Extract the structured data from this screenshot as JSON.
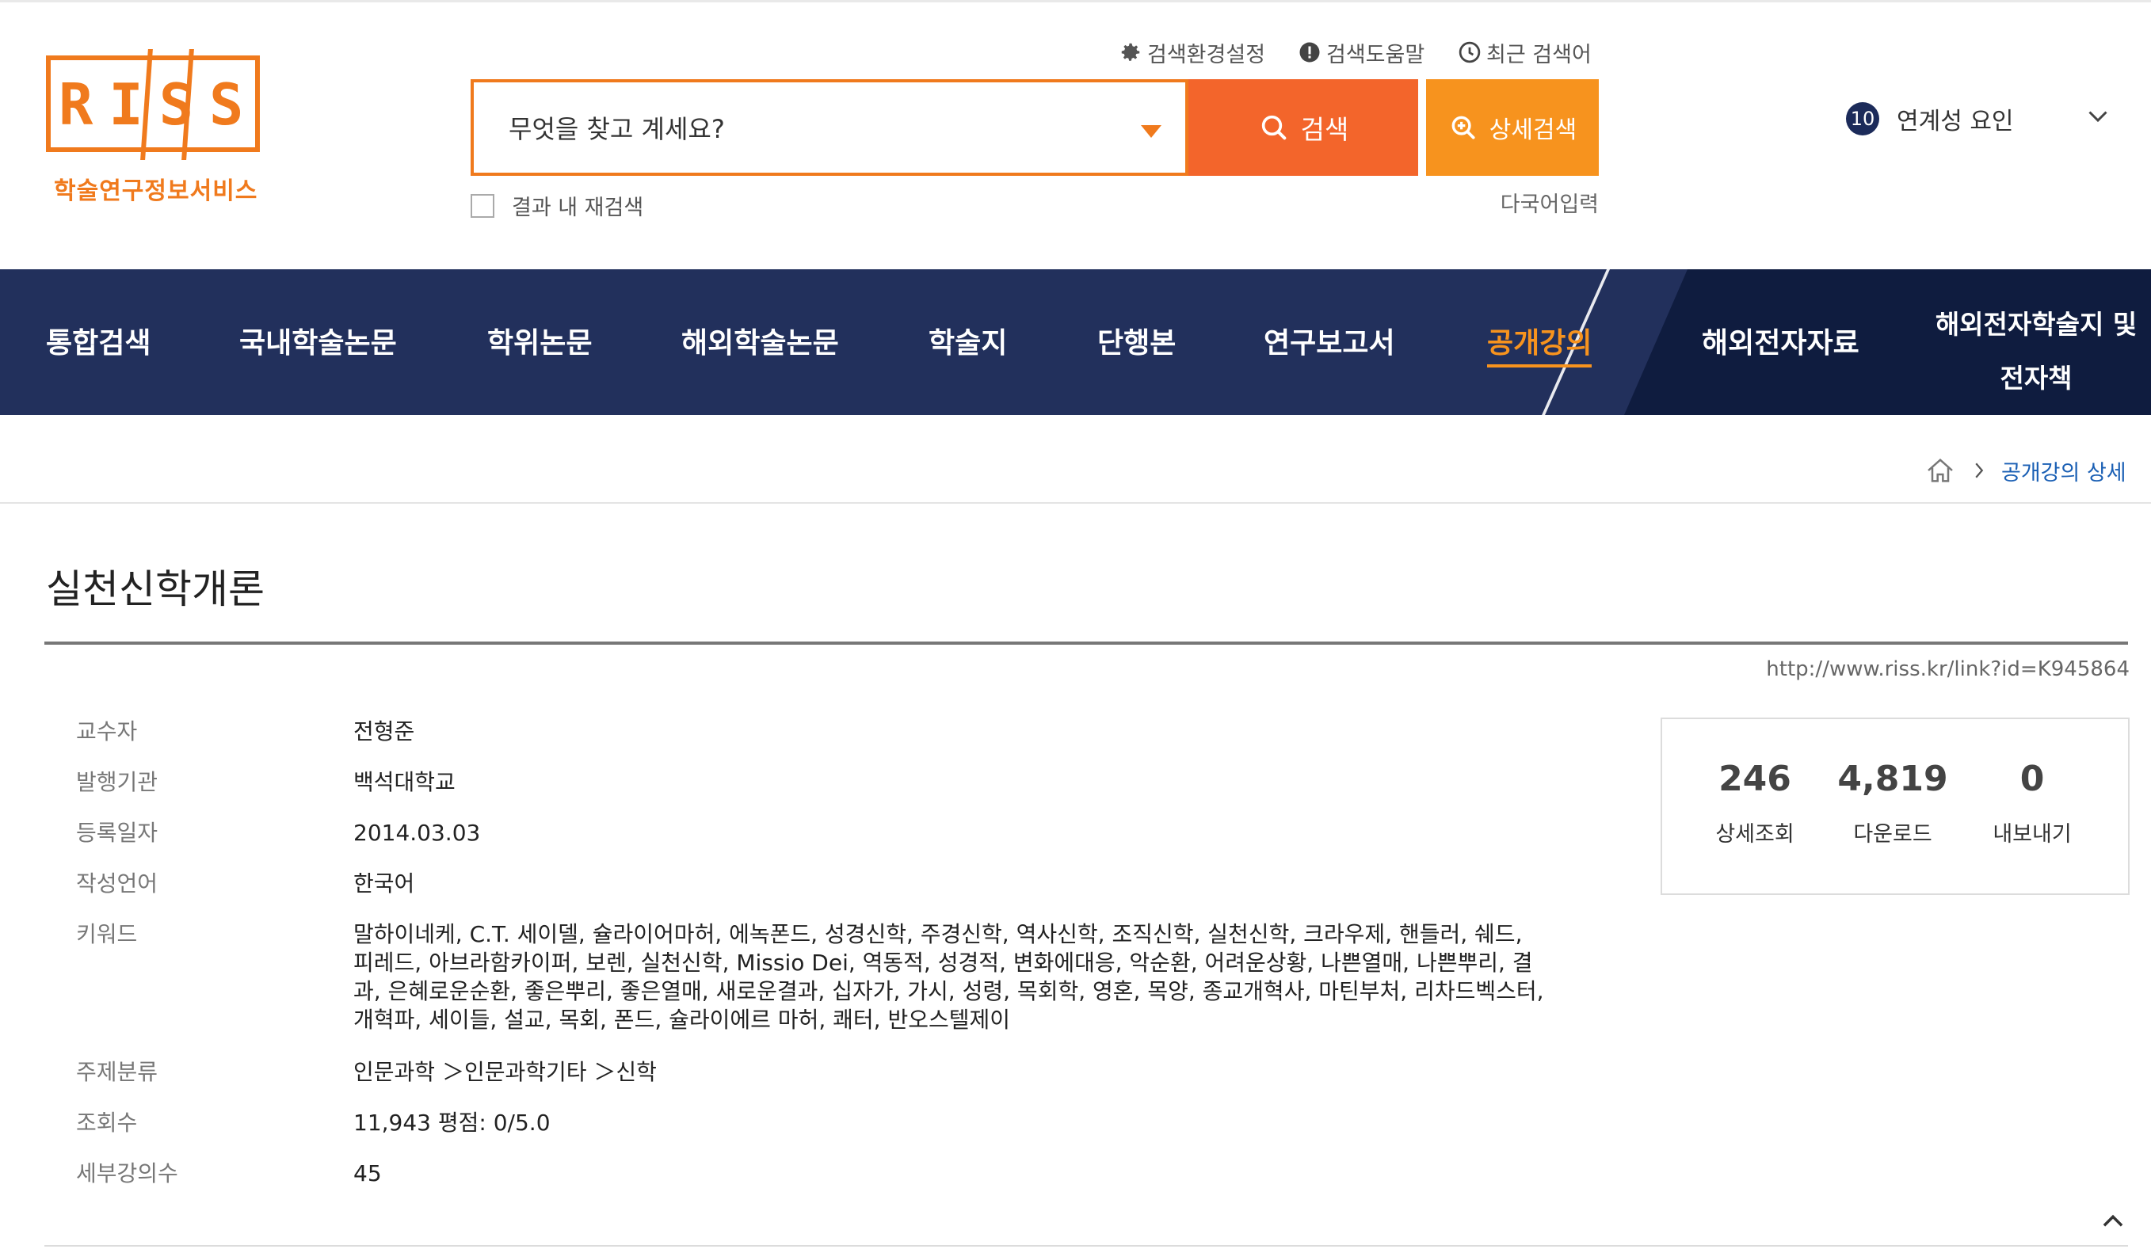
{
  "logo": {
    "letters": "RISS",
    "subtitle": "학술연구정보서비스",
    "brand_color": "#f07a1d"
  },
  "util_links": {
    "settings": "검색환경설정",
    "help": "검색도움말",
    "recent": "최근 검색어"
  },
  "search": {
    "placeholder": "무엇을 찾고 계세요?",
    "search_button": "검색",
    "advanced_button": "상세검색",
    "within_results": "결과 내 재검색",
    "multilang": "다국어입력"
  },
  "related": {
    "count": "10",
    "label": "연계성 요인"
  },
  "nav": {
    "items": [
      "통합검색",
      "국내학술논문",
      "학위논문",
      "해외학술논문",
      "학술지",
      "단행본",
      "연구보고서",
      "공개강의",
      "해외전자자료"
    ],
    "active": "공개강의",
    "last_line1": "해외전자학술지 및",
    "last_line2": "전자책",
    "bg_color": "#22305c",
    "active_color": "#f7931e"
  },
  "breadcrumb": {
    "current": "공개강의 상세"
  },
  "lecture": {
    "title": "실천신학개론",
    "link": "http://www.riss.kr/link?id=K945864",
    "fields": [
      {
        "label": "교수자",
        "value": "전형준"
      },
      {
        "label": "발행기관",
        "value": "백석대학교"
      },
      {
        "label": "등록일자",
        "value": "2014.03.03"
      },
      {
        "label": "작성언어",
        "value": "한국어"
      },
      {
        "label": "키워드",
        "value": "말하이네케, C.T. 세이델, 슐라이어마허, 에녹폰드, 성경신학, 주경신학, 역사신학, 조직신학, 실천신학, 크라우제, 핸들러, 쉐드, 피레드, 아브라함카이퍼, 보렌, 실천신학, Missio Dei, 역동적, 성경적, 변화에대응, 악순환, 어려운상황, 나쁜열매, 나쁜뿌리, 결과, 은혜로운순환, 좋은뿌리, 좋은열매, 새로운결과, 십자가, 가시, 성령, 목회학, 영혼, 목양, 종교개혁사, 마틴부처, 리차드벡스터, 개혁파, 세이들, 설교, 목회, 폰드, 슐라이에르 마허, 쾌터, 반오스텔제이"
      },
      {
        "label": "주제분류",
        "value": "인문과학 ＞인문과학기타 ＞신학"
      },
      {
        "label": "조회수",
        "value": "11,943  평점: 0/5.0"
      },
      {
        "label": "세부강의수",
        "value": "45"
      }
    ]
  },
  "stats": [
    {
      "num": "246",
      "label": "상세조회"
    },
    {
      "num": "4,819",
      "label": "다운로드"
    },
    {
      "num": "0",
      "label": "내보내기"
    }
  ]
}
